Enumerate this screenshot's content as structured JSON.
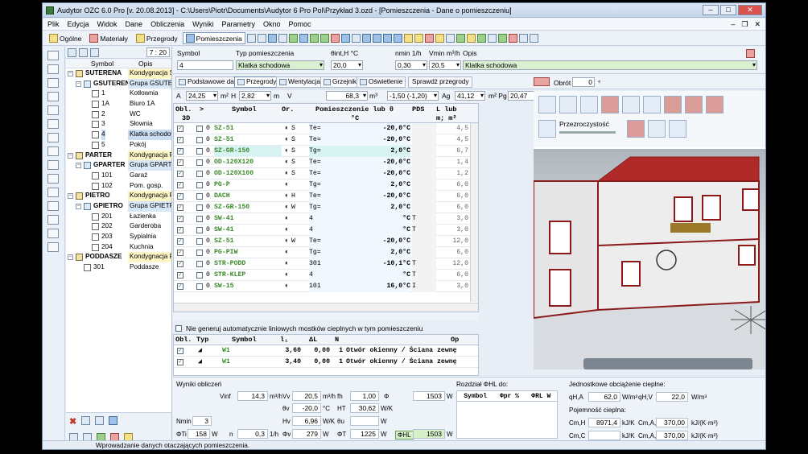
{
  "window": {
    "title": "Audytor OZC 6.0 Pro [v. 20.08.2013] - C:\\Users\\Piotr\\Documents\\Audytor 6 Pro Pol\\Przykład 3.ozd - [Pomieszczenia - Dane o pomieszczeniu]"
  },
  "menu": [
    "Plik",
    "Edycja",
    "Widok",
    "Dane",
    "Obliczenia",
    "Wyniki",
    "Parametry",
    "Okno",
    "Pomoc"
  ],
  "toolbar": {
    "tabs": [
      "Ogólne",
      "Materiały",
      "Przegrody",
      "Pomieszczenia"
    ],
    "active": "Pomieszczenia"
  },
  "tree": {
    "time": "7 : 20",
    "header": {
      "symbol": "Symbol",
      "opis": "Opis"
    },
    "rows": [
      {
        "type": "level",
        "name": "SUTERENA",
        "desc": "Kondygnacja SUTERENA",
        "indent": 0
      },
      {
        "type": "grp",
        "name": "GSUTEREN",
        "desc": "Grupa GSUTEREN",
        "indent": 1
      },
      {
        "type": "room",
        "name": "1",
        "desc": "Kotłownia",
        "indent": 2
      },
      {
        "type": "room",
        "name": "1A",
        "desc": "Biuro 1A",
        "indent": 2
      },
      {
        "type": "room",
        "name": "2",
        "desc": "WC",
        "indent": 2
      },
      {
        "type": "room",
        "name": "3",
        "desc": "Słownia",
        "indent": 2
      },
      {
        "type": "room sel",
        "name": "4",
        "desc": "Klatka schodowa",
        "indent": 2
      },
      {
        "type": "room",
        "name": "5",
        "desc": "Pokój",
        "indent": 2
      },
      {
        "type": "level",
        "name": "PARTER",
        "desc": "Kondygnacja PARTER",
        "indent": 0
      },
      {
        "type": "grp",
        "name": "GPARTER",
        "desc": "Grupa GPARTER",
        "indent": 1
      },
      {
        "type": "room",
        "name": "101",
        "desc": "Garaż",
        "indent": 2
      },
      {
        "type": "room",
        "name": "102",
        "desc": "Pom. gosp.",
        "indent": 2
      },
      {
        "type": "level",
        "name": "PIETRO",
        "desc": "Kondygnacja PIETRO",
        "indent": 0
      },
      {
        "type": "grp",
        "name": "GPIETRO",
        "desc": "Grupa GPIETRO",
        "indent": 1
      },
      {
        "type": "room",
        "name": "201",
        "desc": "Łazienka",
        "indent": 2
      },
      {
        "type": "room",
        "name": "202",
        "desc": "Garderoba",
        "indent": 2
      },
      {
        "type": "room",
        "name": "203",
        "desc": "Sypialnia",
        "indent": 2
      },
      {
        "type": "room",
        "name": "204",
        "desc": "Kuchnia",
        "indent": 2
      },
      {
        "type": "level",
        "name": "PODDASZE",
        "desc": "Kondygnacja PODDASZE",
        "indent": 0
      },
      {
        "type": "room",
        "name": "301",
        "desc": "Poddasze",
        "indent": 1
      }
    ]
  },
  "room": {
    "symbol_label": "Symbol",
    "symbol": "4",
    "typ_label": "Typ pomieszczenia",
    "typ": "Klatka schodowa",
    "temp_label": "θint,H °C",
    "temp": "20,0",
    "nmin_label": "nmin 1/h",
    "nmin": "0,30",
    "vmin_label": "Vmin m³/h",
    "vmin": "20,5",
    "opis_label": "Opis",
    "opis": "Klatka schodowa",
    "a_label": "A",
    "a": "24,25",
    "a_unit": "m²",
    "h_label": "H",
    "h": "2,82",
    "h_unit": "m",
    "v_label": "V",
    "v": "68,3",
    "v_unit": "m³",
    "dt": "-1,50 (-1,20)",
    "ag_label": "Ag",
    "ag": "41,12",
    "apg_label": "m² Pg",
    "apg": "20,47",
    "apg_unit": "m",
    "obrot_label": "Obrót",
    "obrot": "0",
    "obrot_unit": "°"
  },
  "tabs": [
    "Podstawowe dane",
    "Przegrody",
    "Wentylacja",
    "Grzejniki",
    "Oświetlenie"
  ],
  "active_tab": "Przegrody",
  "check_button": "Sprawdź przegrody",
  "grid": {
    "headers": {
      "obl": "Obl.",
      "sym": "Symbol",
      "or": "Or.",
      "room": "Pomieszczenie lub θ",
      "pds": "PDS",
      "lub": "L lub",
      "3d": "3D",
      "c": "°C",
      "m2": "m; m²"
    },
    "rows": [
      {
        "sym": "SZ-51",
        "or": "S",
        "t": "Te=",
        "val": "-20,0°C",
        "pds": "",
        "lub": "4,5"
      },
      {
        "sym": "SZ-51",
        "or": "S",
        "t": "Te=",
        "val": "-20,0°C",
        "pds": "",
        "lub": "4,5"
      },
      {
        "sym": "SZ-GR-150",
        "or": "S",
        "t": "Tg=",
        "val": "2,0°C",
        "pds": "",
        "lub": "6,7",
        "hl": true
      },
      {
        "sym": "OD-120X120",
        "or": "S",
        "t": "Te=",
        "val": "-20,0°C",
        "pds": "",
        "lub": "1,4"
      },
      {
        "sym": "OD-120X100",
        "or": "S",
        "t": "Te=",
        "val": "-20,0°C",
        "pds": "",
        "lub": "1,2"
      },
      {
        "sym": "PG-P",
        "or": "",
        "t": "Tg=",
        "val": "2,0°C",
        "pds": "",
        "lub": "6,0"
      },
      {
        "sym": "DACH",
        "or": "H",
        "t": "Te=",
        "val": "-20,0°C",
        "pds": "",
        "lub": "6,0"
      },
      {
        "sym": "SZ-GR-150",
        "or": "W",
        "t": "Tg=",
        "val": "2,0°C",
        "pds": "",
        "lub": "6,0"
      },
      {
        "sym": "SW-41",
        "or": "",
        "t": "4",
        "val": "°C",
        "pds": "T",
        "lub": "3,0"
      },
      {
        "sym": "SW-41",
        "or": "",
        "t": "4",
        "val": "°C",
        "pds": "T",
        "lub": "3,0"
      },
      {
        "sym": "SZ-51",
        "or": "W",
        "t": "Te=",
        "val": "-20,0°C",
        "pds": "",
        "lub": "12,0"
      },
      {
        "sym": "PG-PIW",
        "or": "",
        "t": "Tg=",
        "val": "2,0°C",
        "pds": "",
        "lub": "6,0"
      },
      {
        "sym": "STR-PODD",
        "or": "",
        "t": "301",
        "val": "-10,1°C",
        "pds": "T",
        "lub": "12,0"
      },
      {
        "sym": "STR-KLEP",
        "or": "",
        "t": "4",
        "val": "°C",
        "pds": "T",
        "lub": "6,0"
      },
      {
        "sym": "SW-15",
        "or": "",
        "t": "101",
        "val": "16,0°C",
        "pds": "I",
        "lub": "3,0"
      }
    ]
  },
  "option_text": "Nie generuj automatycznie liniowych mostków cieplnych w tym pomieszczeniu",
  "grid2": {
    "headers": {
      "obl": "Obl.",
      "typ": "Typ",
      "sym": "Symbol",
      "l": "l₁",
      "dl": "ΔL",
      "n": "N",
      "op": "Op"
    },
    "rows": [
      {
        "sym": "W1",
        "l": "3,60",
        "dl": "0,00",
        "n": "1",
        "op": "Otwór okienny / Ściana zewnę"
      },
      {
        "sym": "W1",
        "l": "3,40",
        "dl": "0,00",
        "n": "1",
        "op": "Otwór okienny / Ściana zewnę"
      }
    ]
  },
  "results": {
    "title": "Wyniki obliczeń",
    "vinf_label": "Vinf",
    "vinf": "14,3",
    "vinf_unit": "m³/h",
    "vv_label": "Vv",
    "vv": "20,5",
    "vv_unit": "m³/h",
    "hv_label": "fh",
    "hv": "1,00",
    "phi_label": "Φ",
    "phi": "1503",
    "phi_unit": "W",
    "ts_label": "θv",
    "ts": "-20,0",
    "ts_unit": "°C",
    "ht_label": "HT",
    "ht": "30,62",
    "ht_unit": "W/K",
    "nmin_label": "Nmin",
    "nmin": "3",
    "hv2_label": "Hv",
    "hv2": "6,96",
    "hv2_unit": "W/K",
    "tu_label": "θu",
    "tu_unit": "W",
    "phit_label": "ΦTi",
    "phit": "158",
    "phit_unit": "W",
    "n_label": "n",
    "n": "0,3",
    "n_unit": "1/h",
    "phiv_label": "Φv",
    "phiv": "279",
    "phiv_unit": "W",
    "phit2_label": "ΦT",
    "phit2": "1225",
    "phit2_unit": "W",
    "phihl_label": "ΦHL",
    "phihl": "1503",
    "phihl_unit": "W",
    "rozdzial": "Rozdział ΦHL do:",
    "symtab": {
      "h1": "Symbol",
      "h2": "Φpr %",
      "h3": "ΦRL W"
    },
    "jedn_title": "Jednostkowe obciążenie cieplne:",
    "qha_label": "qH,A",
    "qha": "62,0",
    "qha_unit": "W/m²",
    "qhv_label": "qH,V",
    "qhv": "22,0",
    "qhv_unit": "W/m³",
    "poj_title": "Pojemność cieplna:",
    "cmh_label": "Cm,H",
    "cmh": "8971,4",
    "cmh_unit": "kJ/K",
    "cmha_label": "Cm,A,H",
    "cmha": "370,00",
    "cmha_unit": "kJ/(K·m²)",
    "cmc_label": "Cm,C",
    "cmc_unit": "kJ/K",
    "cmca_label": "Cm,A,C",
    "cmca": "370,00",
    "cmca_unit": "kJ/(K·m²)"
  },
  "view3d": {
    "transparency": "Przezroczystość"
  },
  "status": "Wprowadzanie danych otaczających pomieszczenia."
}
